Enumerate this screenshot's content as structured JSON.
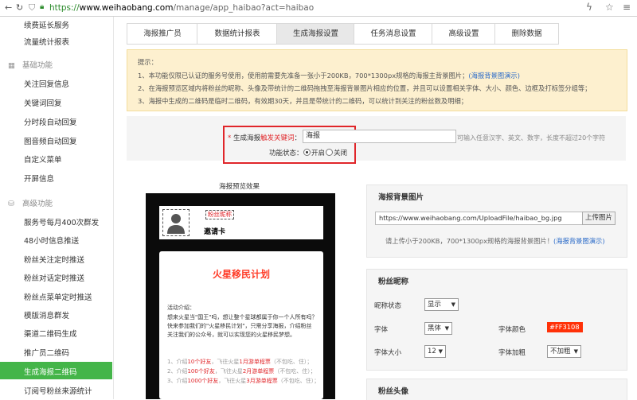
{
  "browser": {
    "url_scheme": "https://",
    "url_host": "www.weihaobang.com",
    "url_path": "/manage/app_haibao?act=haibao"
  },
  "sidebar": {
    "items_top": [
      "续费延长服务",
      "流量统计报表"
    ],
    "group_basic": "基础功能",
    "items_basic": [
      "关注回复信息",
      "关键词回复",
      "分时段自动回复",
      "图音频自动回复",
      "自定义菜单",
      "开屏信息"
    ],
    "group_advanced": "高级功能",
    "items_advanced": [
      "服务号每月400次群发",
      "48小时信息推送",
      "粉丝关注定时推送",
      "粉丝对话定时推送",
      "粉丝点菜单定时推送",
      "模版消息群发",
      "渠道二维码生成",
      "推广员二维码"
    ],
    "active_item": "生成海报二维码",
    "items_bottom": [
      "订阅号粉丝来源统计"
    ]
  },
  "tabs": [
    "海报推广员",
    "数据统计报表",
    "生成海报设置",
    "任务消息设置",
    "高级设置",
    "删除数据"
  ],
  "tips": {
    "title": "提示：",
    "line1": "1、本功能仅限已认证的服务号使用，使用前需要先准备一张小于200KB，700*1300px规格的海报主背景图片；",
    "line1_link": "(海报背景图演示)",
    "line2": "2、在海报预览区域内将粉丝的昵称、头像及带统计的二维码拖拽至海报背景图片相应的位置，并且可以设置相关字体、大小、颜色、边框及打标签分组等；",
    "line3": "3、海报中生成的二维码是临时二维码，有效期30天，并且是带统计的二维码，可以统计到关注的粉丝数及明细；"
  },
  "form": {
    "keyword_label_prefix": "生成海报",
    "keyword_label_highlight": "触发关键词",
    "keyword_label_suffix": "：",
    "keyword_value": "海报",
    "keyword_hint": "可输入任意汉字、英文、数字，长度不超过20个字符",
    "status_label": "功能状态：",
    "status_on": "开启",
    "status_off": "关闭"
  },
  "preview": {
    "label": "海报预览效果",
    "nickname": "粉丝昵称",
    "invite": "邀请卡",
    "title": "火星移民计划",
    "intro_title": "活动介绍：",
    "intro_line1": "想来火星当\"国王\"吗，想让整个星球都属于你一个人所有吗？",
    "intro_line2": "快来参加我们的\"火星移民计划\"，只需分享海报，介绍粉丝",
    "intro_line3": "关注我们的公众号，就可以实现您的火星移民梦想。",
    "rules": [
      {
        "a": "1、介绍",
        "b": "10个好友",
        "c": "，飞往火星",
        "d": "1月游单程票",
        "e": "（不包吃、住）；"
      },
      {
        "a": "2、介绍",
        "b": "100个好友",
        "c": "，飞往火星",
        "d": "2月游单程票",
        "e": "（不包吃、住）；"
      },
      {
        "a": "3、介绍",
        "b": "1000个好友",
        "c": "，飞往火星",
        "d": "3月游单程票",
        "e": "（不包吃、住）；"
      }
    ]
  },
  "bg_panel": {
    "title": "海报背景图片",
    "url": "https://www.weihaobang.com/UploadFile/haibao_bg.jpg",
    "upload_button": "上传图片",
    "hint": "请上传小于200KB，700*1300px规格的海报背景图片！",
    "hint_link": "(海报背景图演示)"
  },
  "nick_panel": {
    "title": "粉丝昵称",
    "display_label": "昵称状态",
    "display_value": "显示",
    "font_label": "字体",
    "font_value": "黑体",
    "color_label": "字体颜色",
    "color_value": "#FF3108",
    "size_label": "字体大小",
    "size_value": "12",
    "bold_label": "字体加粗",
    "bold_value": "不加粗"
  },
  "avatar_panel": {
    "title": "粉丝头像"
  }
}
